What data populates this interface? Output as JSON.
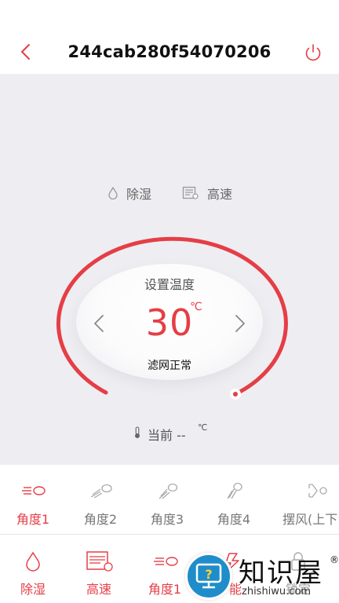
{
  "header": {
    "title": "244cab280f54070206",
    "back_icon": "chevron-left-icon",
    "power_icon": "power-icon"
  },
  "modes": [
    {
      "label": "除湿",
      "icon": "water-drop-icon"
    },
    {
      "label": "高速",
      "icon": "fan-speed-icon"
    }
  ],
  "thermostat": {
    "set_label": "设置温度",
    "temperature": "30",
    "unit": "℃",
    "filter_status": "滤网正常",
    "accent_color": "#e53e46"
  },
  "current": {
    "label": "当前 --",
    "unit": "℃",
    "icon": "thermometer-icon"
  },
  "wind_options": [
    {
      "label": "角度1",
      "icon": "wind-angle-1-icon",
      "active": true
    },
    {
      "label": "角度2",
      "icon": "wind-angle-2-icon",
      "active": false
    },
    {
      "label": "角度3",
      "icon": "wind-angle-3-icon",
      "active": false
    },
    {
      "label": "角度4",
      "icon": "wind-angle-4-icon",
      "active": false
    },
    {
      "label": "摆风(上下",
      "icon": "swing-icon",
      "active": false
    }
  ],
  "bottom_nav": [
    {
      "label": "除湿",
      "icon": "water-drop-icon"
    },
    {
      "label": "高速",
      "icon": "fan-speed-icon"
    },
    {
      "label": "角度1",
      "icon": "wind-angle-icon"
    },
    {
      "label": "能",
      "icon": "energy-icon"
    },
    {
      "label": "锁定",
      "icon": "lock-icon"
    }
  ],
  "watermark": {
    "text": "知识屋",
    "reg": "®",
    "domain": "zhishiwu.com"
  }
}
